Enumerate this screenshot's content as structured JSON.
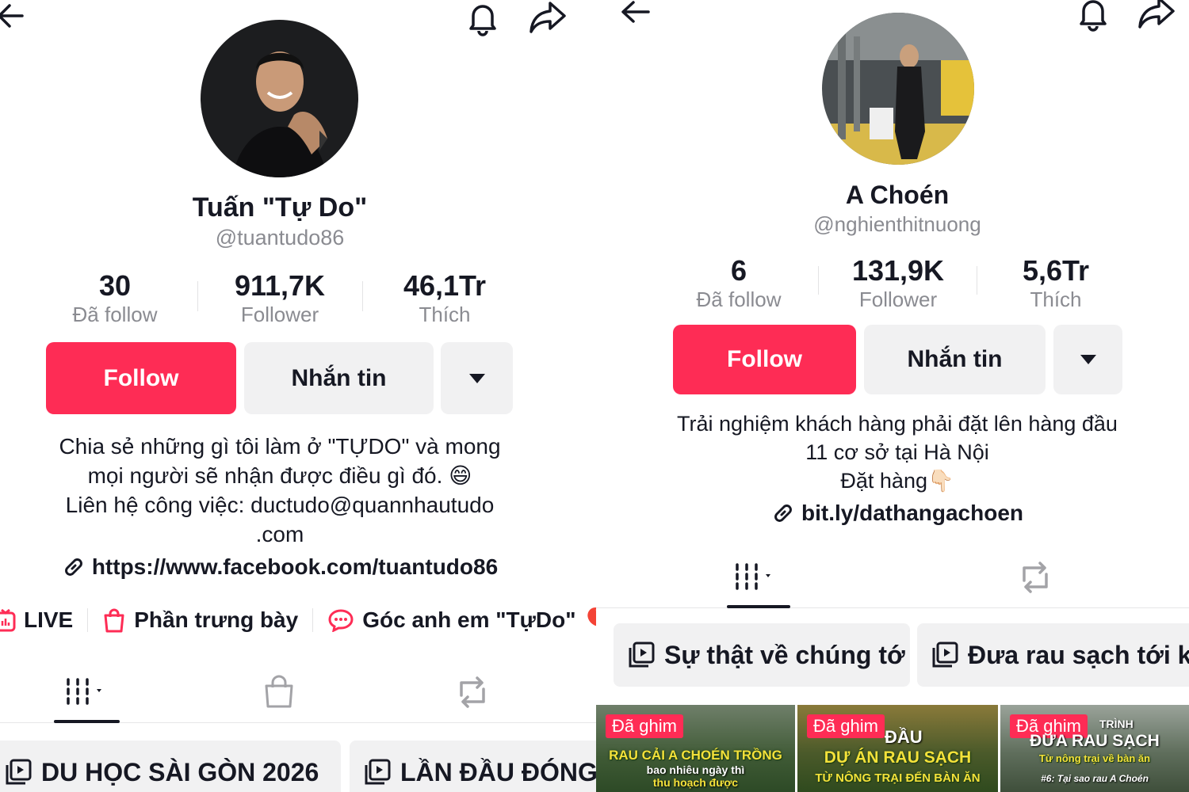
{
  "left": {
    "name": "Tuấn \"Tự Do\"",
    "handle": "@tuantudo86",
    "stats": [
      {
        "value": "30",
        "label": "Đã follow"
      },
      {
        "value": "911,7K",
        "label": "Follower"
      },
      {
        "value": "46,1Tr",
        "label": "Thích"
      }
    ],
    "follow_label": "Follow",
    "message_label": "Nhắn tin",
    "bio_lines": [
      "Chia sẻ những gì tôi làm ở \"TỰDO\" và mong",
      "mọi người sẽ nhận được điều gì đó. 😄",
      "Liên hệ công việc: ductudo@quannhautudo",
      ".com"
    ],
    "link": "https://www.facebook.com/tuantudo86",
    "chips": [
      "LIVE",
      "Phần trưng bày",
      "Góc anh em \"TựDo\" 🎈"
    ],
    "playlists": [
      "DU HỌC SÀI GÒN 2026",
      "LẦN ĐẦU ĐÓNG"
    ]
  },
  "right": {
    "name": "A Choén",
    "handle": "@nghienthitnuong",
    "stats": [
      {
        "value": "6",
        "label": "Đã follow"
      },
      {
        "value": "131,9K",
        "label": "Follower"
      },
      {
        "value": "5,6Tr",
        "label": "Thích"
      }
    ],
    "follow_label": "Follow",
    "message_label": "Nhắn tin",
    "bio_lines": [
      "Trải nghiệm khách hàng phải đặt lên hàng đầu",
      "11 cơ sở tại Hà Nội",
      "Đặt hàng👇🏻"
    ],
    "link": "bit.ly/dathangachoen",
    "playlists": [
      "Sự thật về chúng tớ",
      "Đưa rau sạch tới kh"
    ],
    "videos": [
      {
        "badge": "Đã ghim",
        "title": "RAU CẢI A CHOÉN TRỒNG",
        "sub1": "bao nhiêu ngày thì",
        "sub2": "thu hoạch được"
      },
      {
        "badge": "Đã ghim",
        "title_top": "ĐẦU",
        "title": "DỰ ÁN RAU SẠCH",
        "sub1": "TỪ NÔNG TRẠI ĐẾN BÀN ĂN"
      },
      {
        "badge": "Đã ghim",
        "title_top": "TRÌNH",
        "title": "ĐƯA RAU SẠCH",
        "sub1": "Từ nông trại về bàn ăn",
        "sub2": "#6: Tại sao rau A Choén"
      }
    ]
  },
  "colors": {
    "accent": "#fe2c55",
    "secondary_button": "#f1f1f2",
    "muted_text": "#8a8b91"
  },
  "icons": [
    "back-arrow-icon",
    "bell-icon",
    "share-icon",
    "link-icon",
    "live-icon",
    "shop-bag-icon",
    "chat-bubble-icon",
    "grid-videos-icon",
    "repost-icon",
    "playlist-icon"
  ]
}
